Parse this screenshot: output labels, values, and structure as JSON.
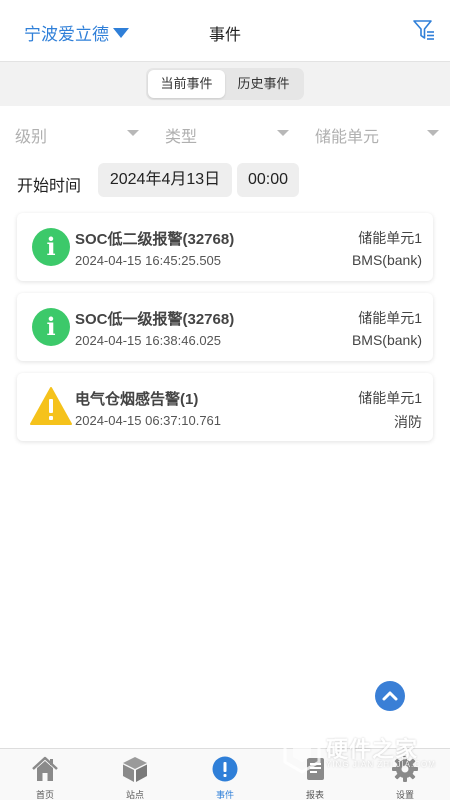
{
  "header": {
    "station_name": "宁波爱立德",
    "title": "事件"
  },
  "segments": [
    "当前事件",
    "历史事件"
  ],
  "filters": {
    "level": "级别",
    "type": "类型",
    "unit": "储能单元"
  },
  "time_filter": {
    "label": "开始时间",
    "date": "2024年4月13日",
    "time": "00:00"
  },
  "events": [
    {
      "icon": "info-icon",
      "title": "SOC低二级报警(32768)",
      "time": "2024-04-15 16:45:25.505",
      "unit": "储能单元1",
      "source": "BMS(bank)"
    },
    {
      "icon": "info-icon",
      "title": "SOC低一级报警(32768)",
      "time": "2024-04-15 16:38:46.025",
      "unit": "储能单元1",
      "source": "BMS(bank)"
    },
    {
      "icon": "warning-icon",
      "title": "电气仓烟感告警(1)",
      "time": "2024-04-15 06:37:10.761",
      "unit": "储能单元1",
      "source": "消防"
    }
  ],
  "tabs": [
    {
      "label": "首页",
      "icon": "home-icon"
    },
    {
      "label": "站点",
      "icon": "cube-icon"
    },
    {
      "label": "事件",
      "icon": "alert-icon",
      "active": true
    },
    {
      "label": "报表",
      "icon": "report-icon"
    },
    {
      "label": "设置",
      "icon": "gear-icon"
    }
  ],
  "watermark": {
    "text": "硬件之家",
    "sub": "YING JIAN ZHI JIA.COM"
  },
  "colors": {
    "accent": "#2f7fd8",
    "info": "#3cc96a",
    "warning": "#f5c21b"
  }
}
